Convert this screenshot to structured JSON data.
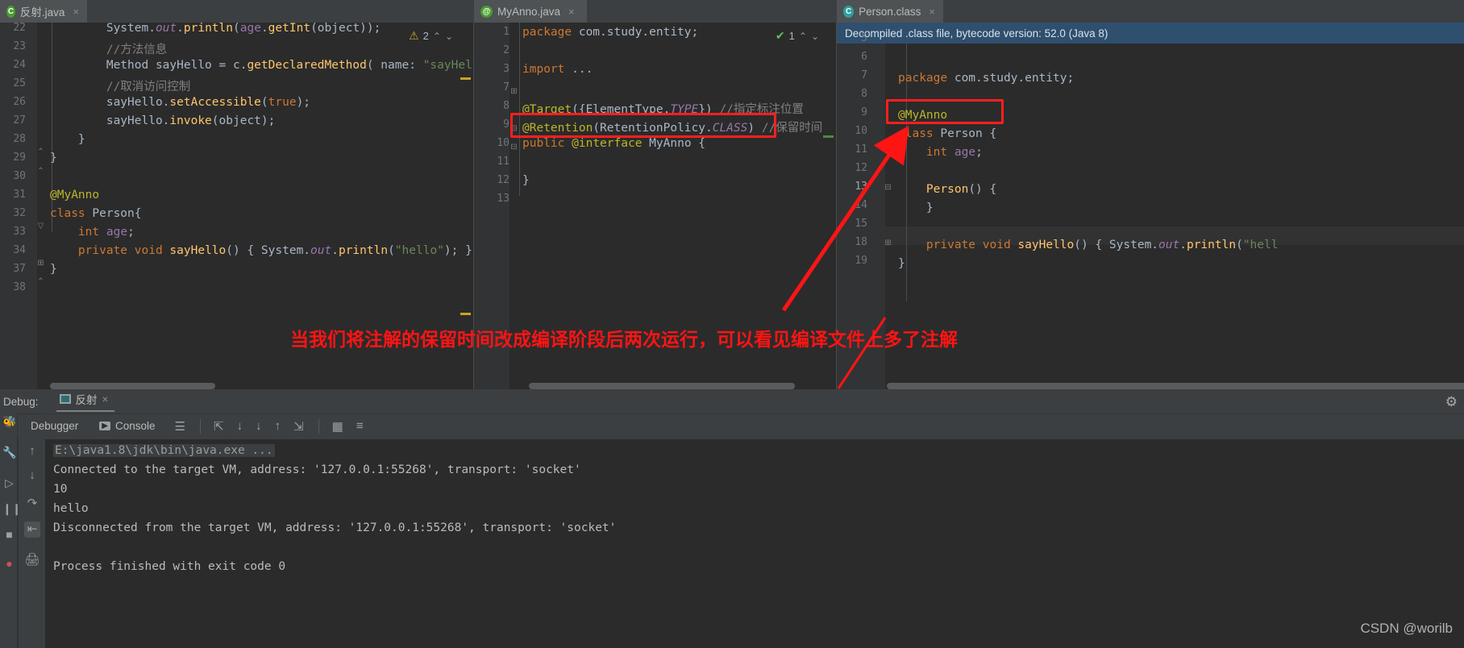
{
  "tabs": [
    {
      "label": "反射.java",
      "icon": "java-class-icon",
      "close": "×"
    },
    {
      "label": "MyAnno.java",
      "icon": "annotation-icon",
      "close": "×"
    },
    {
      "label": "Person.class",
      "icon": "class-file-icon",
      "close": "×"
    }
  ],
  "editor_left": {
    "inspection": {
      "count": "2",
      "up": "⌃",
      "down": "⌄"
    },
    "lines": [
      {
        "n": "22",
        "code": "        System.out.println(age.getInt(object));"
      },
      {
        "n": "23",
        "code": "        //方法信息"
      },
      {
        "n": "24",
        "code": "        Method sayHello = c.getDeclaredMethod( name: \"sayHello\""
      },
      {
        "n": "25",
        "code": "        //取消访问控制"
      },
      {
        "n": "26",
        "code": "        sayHello.setAccessible(true);"
      },
      {
        "n": "27",
        "code": "        sayHello.invoke(object);"
      },
      {
        "n": "28",
        "code": "    }"
      },
      {
        "n": "29",
        "code": "}"
      },
      {
        "n": "30",
        "code": ""
      },
      {
        "n": "31",
        "code": "@MyAnno"
      },
      {
        "n": "32",
        "code": "class Person{"
      },
      {
        "n": "33",
        "code": "    int age;"
      },
      {
        "n": "34",
        "code": "    private void sayHello() { System.out.println(\"hello\"); }"
      },
      {
        "n": "37",
        "code": "}"
      },
      {
        "n": "38",
        "code": ""
      }
    ],
    "hint_param": "name:"
  },
  "editor_mid": {
    "inspection": {
      "count": "1",
      "up": "⌃",
      "down": "⌄"
    },
    "lines": [
      {
        "n": "1",
        "code": "package com.study.entity;"
      },
      {
        "n": "2",
        "code": ""
      },
      {
        "n": "3",
        "code": "import ..."
      },
      {
        "n": "7",
        "code": ""
      },
      {
        "n": "8",
        "code": "@Target({ElementType.TYPE}) //指定标注位置"
      },
      {
        "n": "9",
        "code": "@Retention(RetentionPolicy.CLASS) //保留时间"
      },
      {
        "n": "10",
        "code": "public @interface MyAnno {"
      },
      {
        "n": "11",
        "code": ""
      },
      {
        "n": "12",
        "code": "}"
      },
      {
        "n": "13",
        "code": ""
      }
    ]
  },
  "editor_right": {
    "banner": "Decompiled .class file, bytecode version: 52.0 (Java 8)",
    "lines": [
      {
        "n": "5",
        "code": ""
      },
      {
        "n": "6",
        "code": "package com.study.entity;"
      },
      {
        "n": "7",
        "code": ""
      },
      {
        "n": "8",
        "code": "@MyAnno"
      },
      {
        "n": "9",
        "code": "class Person {"
      },
      {
        "n": "10",
        "code": "    int age;"
      },
      {
        "n": "11",
        "code": ""
      },
      {
        "n": "12",
        "code": "    Person() {"
      },
      {
        "n": "13",
        "code": "    }"
      },
      {
        "n": "14",
        "code": ""
      },
      {
        "n": "15",
        "code": "    private void sayHello() { System.out.println(\"hell"
      },
      {
        "n": "18",
        "code": "}"
      },
      {
        "n": "19",
        "code": ""
      }
    ]
  },
  "annotation": {
    "text": "当我们将注解的保留时间改成编译阶段后两次运行，可以看见编译文件上多了注解",
    "color": "#ff1414"
  },
  "debug": {
    "title": "Debug:",
    "run_config": "反射",
    "close": "×",
    "settings_icon": "gear-icon",
    "tabs": [
      {
        "label": "Debugger",
        "icon": "debugger-icon"
      },
      {
        "label": "Console",
        "icon": "console-icon"
      }
    ],
    "toolbar_icons": [
      "layout-icon",
      "step-over-icon",
      "step-into-icon",
      "force-step-into-icon",
      "step-out-icon",
      "run-to-cursor-icon",
      "evaluate-icon",
      "mute-breakpoints-icon"
    ],
    "rail_icons": [
      "bug-icon",
      "wrench-icon",
      "resume-icon",
      "pause-icon",
      "stop-icon",
      "breakpoint-icon"
    ],
    "rail2_icons": [
      "up-icon",
      "down-icon",
      "soft-wrap-icon",
      "scroll-to-end-icon",
      "print-icon"
    ],
    "console_lines": [
      {
        "text": "E:\\java1.8\\jdk\\bin\\java.exe ...",
        "dim": true
      },
      {
        "text": "Connected to the target VM, address: '127.0.0.1:55268', transport: 'socket'",
        "dim": false
      },
      {
        "text": "10",
        "dim": false
      },
      {
        "text": "hello",
        "dim": false
      },
      {
        "text": "Disconnected from the target VM, address: '127.0.0.1:55268', transport: 'socket'",
        "dim": false
      },
      {
        "text": "",
        "dim": false
      },
      {
        "text": "Process finished with exit code 0",
        "dim": false
      }
    ]
  },
  "watermark": "CSDN @worilb"
}
